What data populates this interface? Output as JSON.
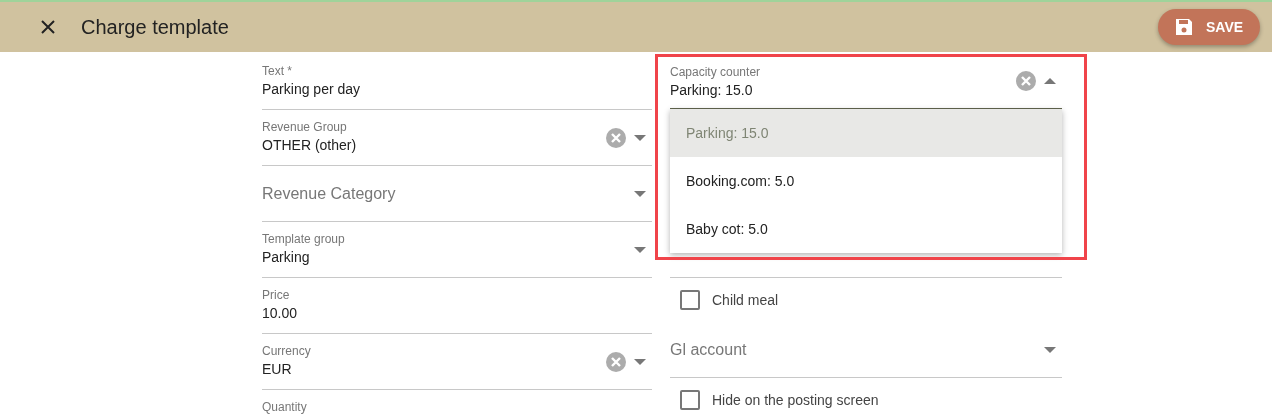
{
  "header": {
    "title": "Charge template",
    "save_label": "SAVE"
  },
  "left_fields": [
    {
      "kind": "text",
      "label": "Text *",
      "value": "Parking per day"
    },
    {
      "kind": "select",
      "label": "Revenue Group",
      "value": "OTHER (other)",
      "clearable": true
    },
    {
      "kind": "select",
      "placeholder": "Revenue Category",
      "clearable": false
    },
    {
      "kind": "select",
      "label": "Template group",
      "value": "Parking",
      "clearable": false
    },
    {
      "kind": "text",
      "label": "Price",
      "value": "10.00"
    },
    {
      "kind": "select",
      "label": "Currency",
      "value": "EUR",
      "clearable": true
    },
    {
      "kind": "text",
      "label": "Quantity"
    }
  ],
  "capacity_counter": {
    "label": "Capacity counter",
    "value": "Parking: 15.0",
    "clearable": true,
    "expanded": true,
    "options": [
      {
        "label": "Parking: 15.0",
        "selected": true
      },
      {
        "label": "Booking.com: 5.0",
        "selected": false
      },
      {
        "label": "Baby cot: 5.0",
        "selected": false
      }
    ]
  },
  "right_fields": [
    {
      "kind": "checkbox",
      "label": "Child meal",
      "checked": false
    },
    {
      "kind": "select",
      "placeholder": "Gl account",
      "clearable": false
    },
    {
      "kind": "checkbox",
      "label": "Hide on the posting screen",
      "checked": false
    }
  ],
  "highlight": {
    "on": true
  }
}
